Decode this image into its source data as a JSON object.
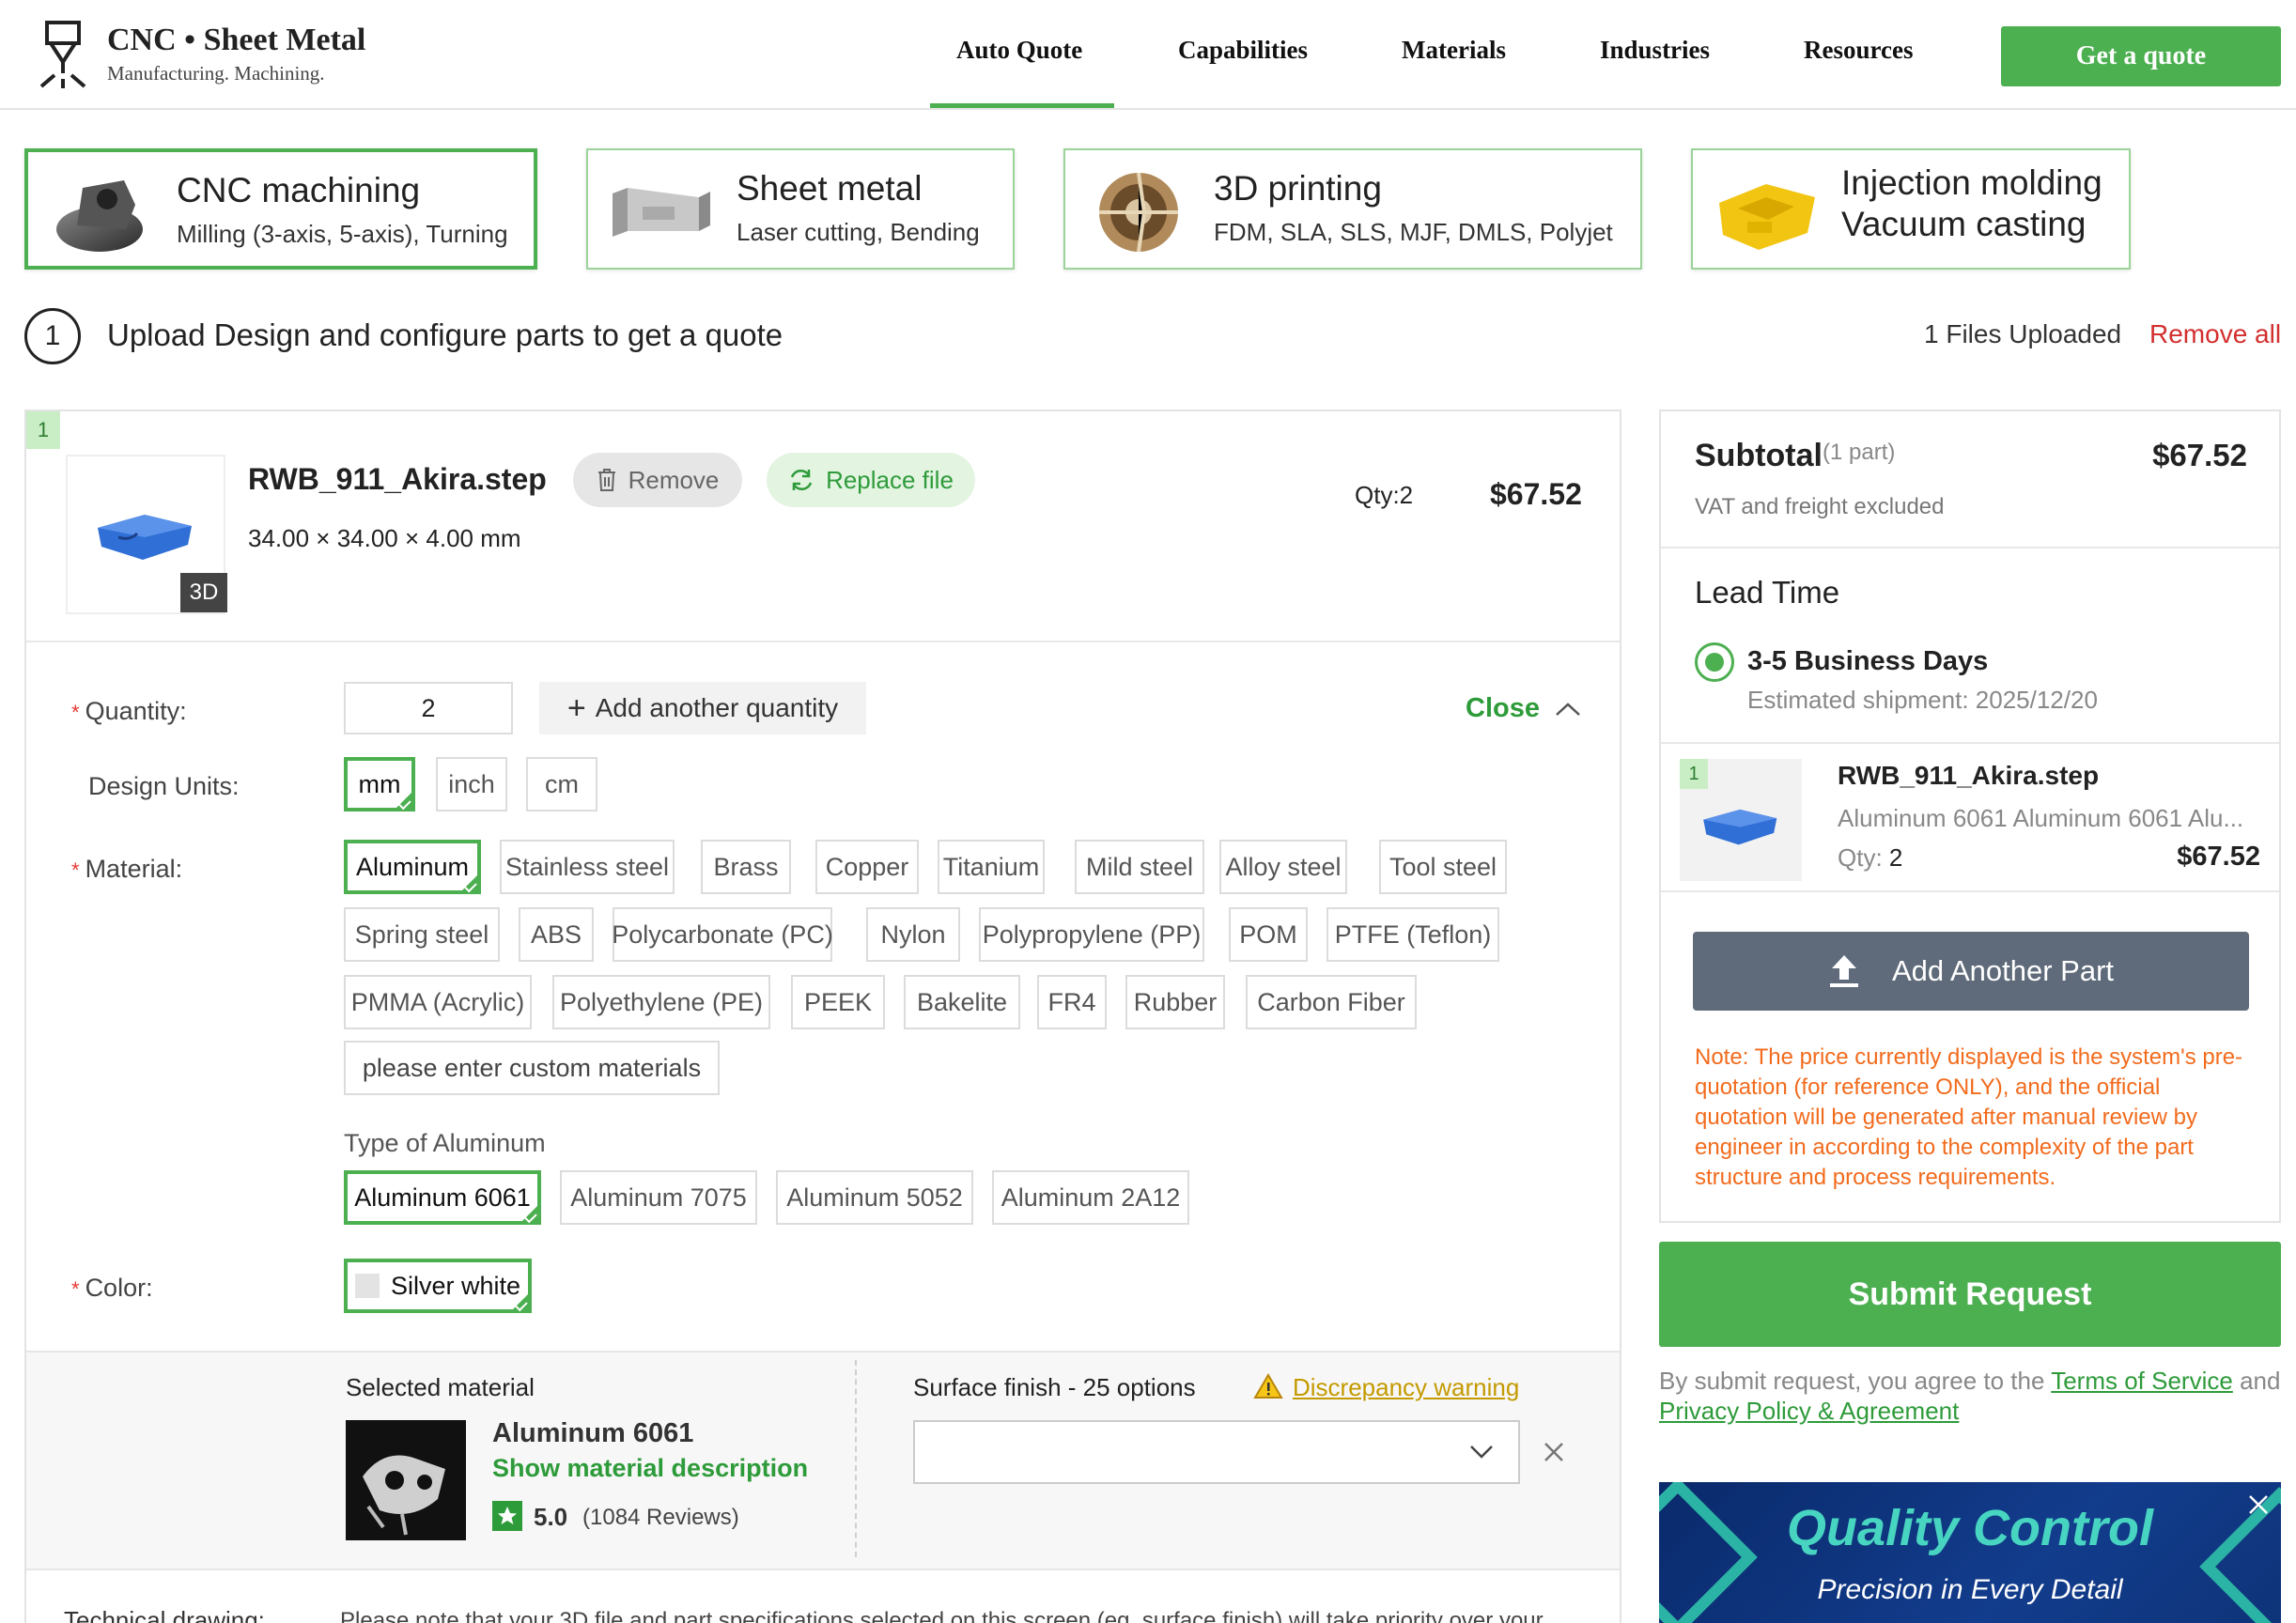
{
  "header": {
    "logo_title": "CNC • Sheet Metal",
    "logo_subtitle": "Manufacturing. Machining.",
    "nav": [
      "Auto Quote",
      "Capabilities",
      "Materials",
      "Industries",
      "Resources"
    ],
    "cta": "Get a quote"
  },
  "processes": [
    {
      "title": "CNC machining",
      "sub": "Milling (3-axis, 5-axis), Turning"
    },
    {
      "title": "Sheet metal",
      "sub": "Laser cutting, Bending"
    },
    {
      "title": "3D printing",
      "sub": "FDM, SLA, SLS, MJF, DMLS, Polyjet"
    },
    {
      "title": "Injection molding",
      "sub": "Vacuum casting"
    }
  ],
  "step": {
    "number": "1",
    "text": "Upload Design and configure parts to get a quote",
    "files_uploaded": "1 Files Uploaded",
    "remove_all": "Remove all"
  },
  "part": {
    "index": "1",
    "file_name": "RWB_911_Akira.step",
    "remove": "Remove",
    "replace": "Replace file",
    "dimensions": "34.00 × 34.00 × 4.00 mm",
    "qty": "Qty:2",
    "price": "$67.52",
    "badge_3d": "3D"
  },
  "config": {
    "quantity_label": "Quantity:",
    "quantity_value": "2",
    "add_quantity": "Add another quantity",
    "close": "Close",
    "units_label": "Design Units:",
    "units": [
      "mm",
      "inch",
      "cm"
    ],
    "material_label": "Material:",
    "materials_row1": [
      "Aluminum",
      "Stainless steel",
      "Brass",
      "Copper",
      "Titanium",
      "Mild steel",
      "Alloy steel",
      "Tool steel"
    ],
    "materials_row2": [
      "Spring steel",
      "ABS",
      "Polycarbonate (PC)",
      "Nylon",
      "Polypropylene (PP)",
      "POM",
      "PTFE (Teflon)"
    ],
    "materials_row3": [
      "PMMA (Acrylic)",
      "Polyethylene (PE)",
      "PEEK",
      "Bakelite",
      "FR4",
      "Rubber",
      "Carbon Fiber"
    ],
    "custom_material_placeholder": "please enter custom materials",
    "type_label": "Type of Aluminum",
    "types": [
      "Aluminum 6061",
      "Aluminum 7075",
      "Aluminum 5052",
      "Aluminum 2A12"
    ],
    "color_label": "Color:",
    "color_value": "Silver white",
    "selected_material_label": "Selected material",
    "selected_material": "Aluminum 6061",
    "show_description": "Show material description",
    "rating": "5.0",
    "reviews": "(1084 Reviews)",
    "surface_label": "Surface finish - 25 options",
    "discrepancy": "Discrepancy warning",
    "tech_label": "Technical drawing:",
    "tech_note": "Please note that your 3D file and part specifications selected on this screen (eg. surface finish) will take priority over your"
  },
  "sidebar": {
    "subtotal": "Subtotal",
    "subtotal_parts": "(1 part)",
    "subtotal_price": "$67.52",
    "vat": "VAT and freight excluded",
    "lead_time": "Lead Time",
    "lead_option": "3-5 Business Days",
    "shipment": "Estimated shipment: 2025/12/20",
    "item_index": "1",
    "item_name": "RWB_911_Akira.step",
    "item_material": "Aluminum 6061 Aluminum 6061 Alu...",
    "item_qty_label": "Qty:",
    "item_qty": "2",
    "item_price": "$67.52",
    "add_part": "Add Another Part",
    "note": "Note: The price currently displayed is the system's pre-quotation (for reference ONLY), and the official quotation will be generated after manual review by engineer in according to the complexity of the part structure and process requirements.",
    "submit": "Submit Request",
    "agree_prefix": "By submit request, you agree to the",
    "terms": "Terms of Service",
    "and": "and",
    "privacy": "Privacy Policy & Agreement"
  },
  "banner": {
    "title": "Quality Control",
    "subtitle": "Precision in Every Detail"
  },
  "colors": {
    "accent": "#4caf50",
    "warning": "#f26b1d",
    "danger": "#d32f2f",
    "button_dark": "#5f6b7a"
  }
}
